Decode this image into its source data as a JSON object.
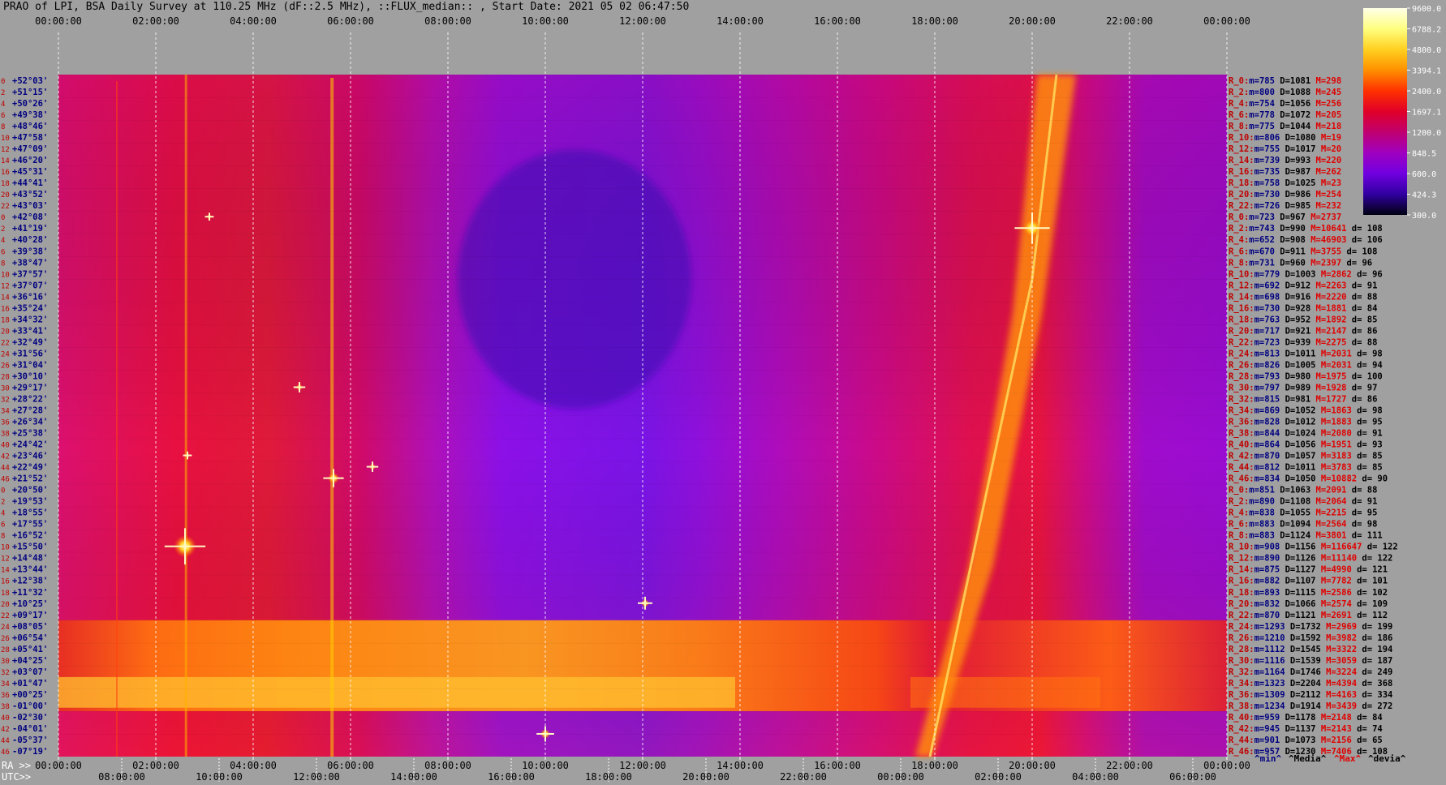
{
  "title": "PRAO of LPI, BSA Daily Survey at 110.25 MHz (dF::2.5 MHz), ::FLUX_median:: , Start Date: 2021 05 02 06:47:50",
  "top_axis_ticks": [
    "00:00:00",
    "02:00:00",
    "04:00:00",
    "06:00:00",
    "08:00:00",
    "10:00:00",
    "12:00:00",
    "14:00:00",
    "16:00:00",
    "18:00:00",
    "20:00:00",
    "22:00:00",
    "00:00:00"
  ],
  "bottom_ra_label": "RA >>",
  "bottom_ra_ticks": [
    "00:00:00",
    "02:00:00",
    "04:00:00",
    "06:00:00",
    "08:00:00",
    "10:00:00",
    "12:00:00",
    "14:00:00",
    "16:00:00",
    "18:00:00",
    "20:00:00",
    "22:00:00",
    "00:00:00"
  ],
  "bottom_utc_label": "UTC>>",
  "bottom_utc_ticks": [
    "08:00:00",
    "10:00:00",
    "12:00:00",
    "14:00:00",
    "16:00:00",
    "18:00:00",
    "20:00:00",
    "22:00:00",
    "00:00:00",
    "02:00:00",
    "04:00:00",
    "06:00:00"
  ],
  "colorbar": {
    "ticks": [
      "9600.0",
      "6788.2",
      "4800.0",
      "3394.1",
      "2400.0",
      "1697.1",
      "1200.0",
      "848.5",
      "600.0",
      "424.3",
      "300.0"
    ],
    "colors": [
      "#ffffe8",
      "#ffff80",
      "#ffd020",
      "#ff9000",
      "#ff3000",
      "#e00028",
      "#c00070",
      "#a000c0",
      "#7000e0",
      "#3000a0",
      "#000010"
    ]
  },
  "legend_footer": [
    "^min^",
    "^Media^",
    "^Max^",
    "^devia^"
  ],
  "colors": {
    "min": "#000080",
    "median": "#000000",
    "max": "#e00000",
    "deviation": "#000000",
    "row_num": "#c00000",
    "dec": "#000080"
  },
  "chart_data": {
    "type": "heatmap",
    "x_axis": "RA (hours), 00:00:00 to 24:00:00",
    "y_axis": "Declination",
    "row_numbers": [
      "0",
      "2",
      "4",
      "6",
      "8",
      "10",
      "12",
      "14",
      "16",
      "18",
      "20",
      "22",
      "0",
      "2",
      "4",
      "6",
      "8",
      "10",
      "12",
      "14",
      "16",
      "18",
      "20",
      "22",
      "24",
      "26",
      "28",
      "30",
      "32",
      "34",
      "36",
      "38",
      "40",
      "42",
      "44",
      "46",
      "0",
      "2",
      "4",
      "6",
      "8",
      "10",
      "12",
      "14",
      "16",
      "18",
      "20",
      "22",
      "24",
      "26",
      "28",
      "30",
      "32",
      "34",
      "36",
      "38",
      "40",
      "42",
      "44",
      "46"
    ],
    "declinations": [
      "+52°03'",
      "+51°15'",
      "+50°26'",
      "+49°38'",
      "+48°46'",
      "+47°58'",
      "+47°09'",
      "+46°20'",
      "+45°31'",
      "+44°41'",
      "+43°52'",
      "+43°03'",
      "+42°08'",
      "+41°19'",
      "+40°28'",
      "+39°38'",
      "+38°47'",
      "+37°57'",
      "+37°07'",
      "+36°16'",
      "+35°24'",
      "+34°32'",
      "+33°41'",
      "+32°49'",
      "+31°56'",
      "+31°04'",
      "+30°10'",
      "+29°17'",
      "+28°22'",
      "+27°28'",
      "+26°34'",
      "+25°38'",
      "+24°42'",
      "+23°46'",
      "+22°49'",
      "+21°52'",
      "+20°50'",
      "+19°53'",
      "+18°55'",
      "+17°55'",
      "+16°52'",
      "+15°50'",
      "+14°48'",
      "+13°44'",
      "+12°38'",
      "+11°32'",
      "+10°25'",
      "+09°17'",
      "+08°05'",
      "+06°54'",
      "+05°41'",
      "+04°25'",
      "+03°07'",
      "+01°47'",
      "+00°25'",
      "-01°00'",
      "-02°30'",
      "-04°01'",
      "-05°37'",
      "-07°19'"
    ],
    "stats": [
      [
        "R_0:",
        "785",
        "1081",
        "298",
        ""
      ],
      [
        "R_2:",
        "800",
        "1088",
        "245",
        ""
      ],
      [
        "R_4:",
        "754",
        "1056",
        "256",
        ""
      ],
      [
        "R_6:",
        "778",
        "1072",
        "205",
        ""
      ],
      [
        "R_8:",
        "775",
        "1044",
        "218",
        ""
      ],
      [
        "R_10:",
        "806",
        "1080",
        "19",
        ""
      ],
      [
        "R_12:",
        "755",
        "1017",
        "20",
        ""
      ],
      [
        "R_14:",
        "739",
        "993",
        "220",
        ""
      ],
      [
        "R_16:",
        "735",
        "987",
        "262",
        ""
      ],
      [
        "R_18:",
        "758",
        "1025",
        "23",
        ""
      ],
      [
        "R_20:",
        "730",
        "986",
        "254",
        ""
      ],
      [
        "R_22:",
        "726",
        "985",
        "232",
        ""
      ],
      [
        "R_0:",
        "723",
        "967",
        "2737",
        ""
      ],
      [
        "R_2:",
        "743",
        "990",
        "10641",
        "108"
      ],
      [
        "R_4:",
        "652",
        "908",
        "46903",
        "106"
      ],
      [
        "R_6:",
        "670",
        "911",
        "3755",
        "108"
      ],
      [
        "R_8:",
        "731",
        "960",
        "2397",
        "96"
      ],
      [
        "R_10:",
        "779",
        "1003",
        "2862",
        "96"
      ],
      [
        "R_12:",
        "692",
        "912",
        "2263",
        "91"
      ],
      [
        "R_14:",
        "698",
        "916",
        "2220",
        "88"
      ],
      [
        "R_16:",
        "730",
        "928",
        "1881",
        "84"
      ],
      [
        "R_18:",
        "763",
        "952",
        "1892",
        "85"
      ],
      [
        "R_20:",
        "717",
        "921",
        "2147",
        "86"
      ],
      [
        "R_22:",
        "723",
        "939",
        "2275",
        "88"
      ],
      [
        "R_24:",
        "813",
        "1011",
        "2031",
        "98"
      ],
      [
        "R_26:",
        "826",
        "1005",
        "2031",
        "94"
      ],
      [
        "R_28:",
        "793",
        "980",
        "1975",
        "100"
      ],
      [
        "R_30:",
        "797",
        "989",
        "1928",
        "97"
      ],
      [
        "R_32:",
        "815",
        "981",
        "1727",
        "86"
      ],
      [
        "R_34:",
        "869",
        "1052",
        "1863",
        "98"
      ],
      [
        "R_36:",
        "828",
        "1012",
        "1883",
        "95"
      ],
      [
        "R_38:",
        "844",
        "1024",
        "2080",
        "91"
      ],
      [
        "R_40:",
        "864",
        "1056",
        "1951",
        "93"
      ],
      [
        "R_42:",
        "870",
        "1057",
        "3183",
        "85"
      ],
      [
        "R_44:",
        "812",
        "1011",
        "3783",
        "85"
      ],
      [
        "R_46:",
        "834",
        "1050",
        "10882",
        "90"
      ],
      [
        "R_0:",
        "851",
        "1063",
        "2091",
        "88"
      ],
      [
        "R_2:",
        "890",
        "1108",
        "2064",
        "91"
      ],
      [
        "R_4:",
        "838",
        "1055",
        "2215",
        "95"
      ],
      [
        "R_6:",
        "883",
        "1094",
        "2564",
        "98"
      ],
      [
        "R_8:",
        "883",
        "1124",
        "3801",
        "111"
      ],
      [
        "R_10:",
        "908",
        "1156",
        "116647",
        "122"
      ],
      [
        "R_12:",
        "890",
        "1126",
        "11140",
        "122"
      ],
      [
        "R_14:",
        "875",
        "1127",
        "4990",
        "121"
      ],
      [
        "R_16:",
        "882",
        "1107",
        "7782",
        "101"
      ],
      [
        "R_18:",
        "893",
        "1115",
        "2586",
        "102"
      ],
      [
        "R_20:",
        "832",
        "1066",
        "2574",
        "109"
      ],
      [
        "R_22:",
        "870",
        "1121",
        "2691",
        "112"
      ],
      [
        "R_24:",
        "1293",
        "1732",
        "2969",
        "199"
      ],
      [
        "R_26:",
        "1210",
        "1592",
        "3982",
        "186"
      ],
      [
        "R_28:",
        "1112",
        "1545",
        "3322",
        "194"
      ],
      [
        "R_30:",
        "1116",
        "1539",
        "3059",
        "187"
      ],
      [
        "R_32:",
        "1164",
        "1746",
        "3224",
        "249"
      ],
      [
        "R_34:",
        "1323",
        "2204",
        "4394",
        "368"
      ],
      [
        "R_36:",
        "1309",
        "2112",
        "4163",
        "334"
      ],
      [
        "R_38:",
        "1234",
        "1914",
        "3439",
        "272"
      ],
      [
        "R_40:",
        "959",
        "1178",
        "2148",
        "84"
      ],
      [
        "R_42:",
        "945",
        "1137",
        "2143",
        "74"
      ],
      [
        "R_44:",
        "901",
        "1073",
        "2156",
        "65"
      ],
      [
        "R_46:",
        "957",
        "1230",
        "7406",
        "108"
      ]
    ]
  }
}
